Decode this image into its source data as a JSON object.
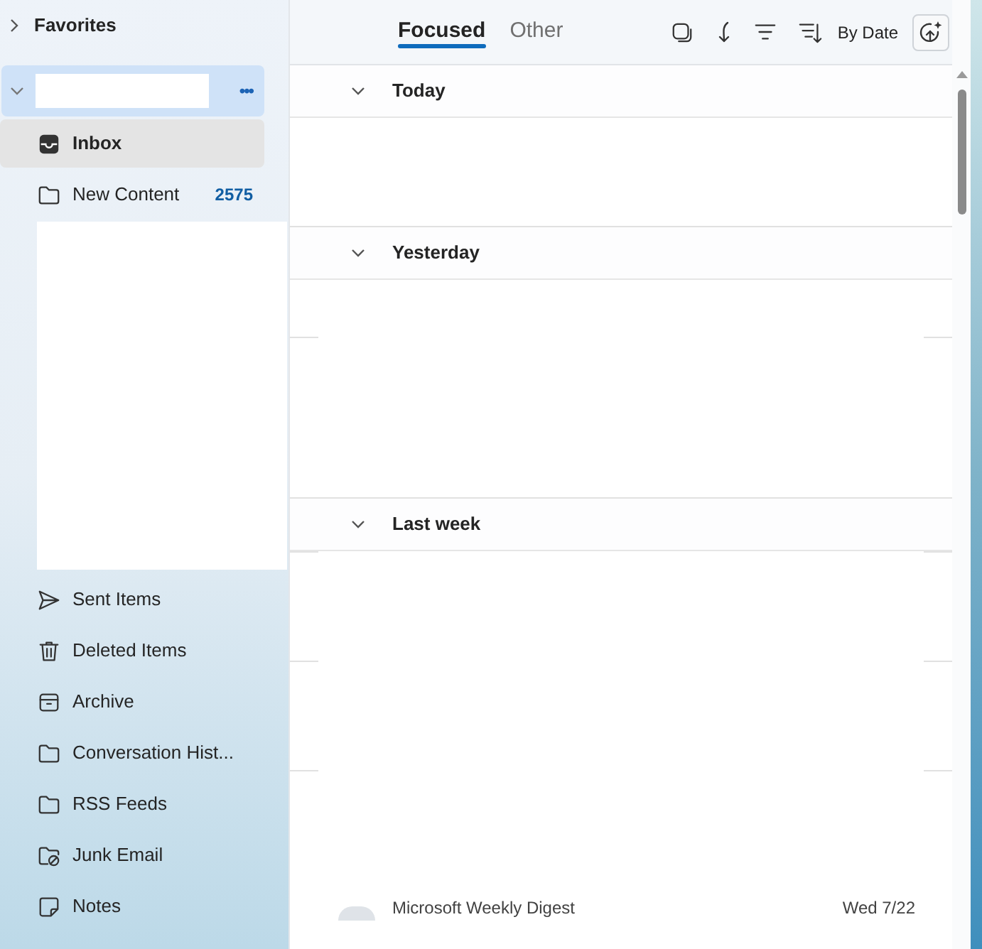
{
  "sidebar": {
    "favorites": {
      "label": "Favorites",
      "expanded": false
    },
    "account": {
      "expanded": true,
      "more": "•••"
    },
    "folders": [
      {
        "kind": "inbox",
        "label": "Inbox",
        "selected": true
      },
      {
        "kind": "folder",
        "label": "New Content",
        "count": "2575",
        "selected": false
      },
      {
        "kind": "sent",
        "label": "Sent Items",
        "selected": false
      },
      {
        "kind": "trash",
        "label": "Deleted Items",
        "selected": false
      },
      {
        "kind": "archive",
        "label": "Archive",
        "selected": false
      },
      {
        "kind": "folder",
        "label": "Conversation Hist...",
        "selected": false
      },
      {
        "kind": "folder",
        "label": "RSS Feeds",
        "selected": false
      },
      {
        "kind": "junk",
        "label": "Junk Email",
        "selected": false
      },
      {
        "kind": "notes",
        "label": "Notes",
        "selected": false
      }
    ]
  },
  "tabs": [
    {
      "label": "Focused",
      "selected": true
    },
    {
      "label": "Other",
      "selected": false
    }
  ],
  "toolbar": {
    "sort_label": "By Date"
  },
  "groups": [
    {
      "label": "Today",
      "expanded": true
    },
    {
      "label": "Yesterday",
      "expanded": true
    },
    {
      "label": "Last week",
      "expanded": true
    }
  ],
  "message": {
    "sender": "Microsoft Weekly Digest",
    "date": "Wed 7/22"
  }
}
